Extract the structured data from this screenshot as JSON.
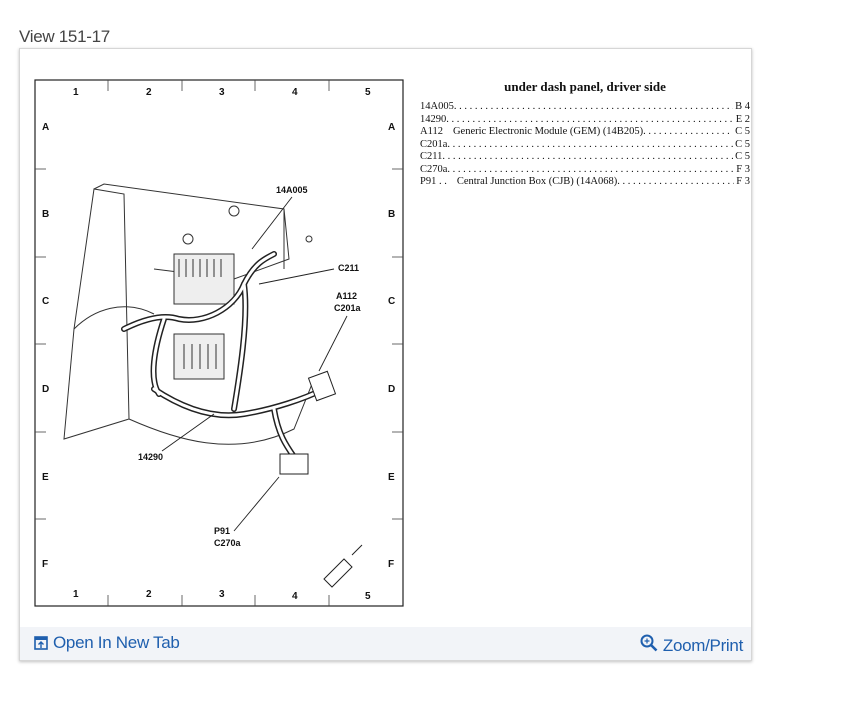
{
  "view_title": "View 151-17",
  "diagram": {
    "columns": [
      "1",
      "2",
      "3",
      "4",
      "5"
    ],
    "rows": [
      "A",
      "B",
      "C",
      "D",
      "E",
      "F"
    ],
    "callouts": {
      "c14A005": "14A005",
      "c211": "C211",
      "a112": "A112",
      "c201a": "C201a",
      "c14290": "14290",
      "p91": "P91",
      "c270a": "C270a"
    }
  },
  "legend": {
    "title": "under dash panel, driver side",
    "items": [
      {
        "id": "14A005",
        "desc": "",
        "loc": "B 4"
      },
      {
        "id": "14290",
        "desc": "",
        "loc": "E 2"
      },
      {
        "id": "A112",
        "desc": "Generic Electronic Module (GEM) (14B205)",
        "loc": "C 5"
      },
      {
        "id": "C201a",
        "desc": "",
        "loc": "C 5"
      },
      {
        "id": "C211",
        "desc": "",
        "loc": "C 5"
      },
      {
        "id": "C270a",
        "desc": "",
        "loc": "F 3"
      },
      {
        "id": "P91 . .",
        "desc": "Central Junction Box (CJB) (14A068)",
        "loc": "F 3"
      }
    ]
  },
  "footer": {
    "open_tab": "Open In New Tab",
    "zoom_print": "Zoom/Print",
    "link_color": "#1f5fae"
  }
}
